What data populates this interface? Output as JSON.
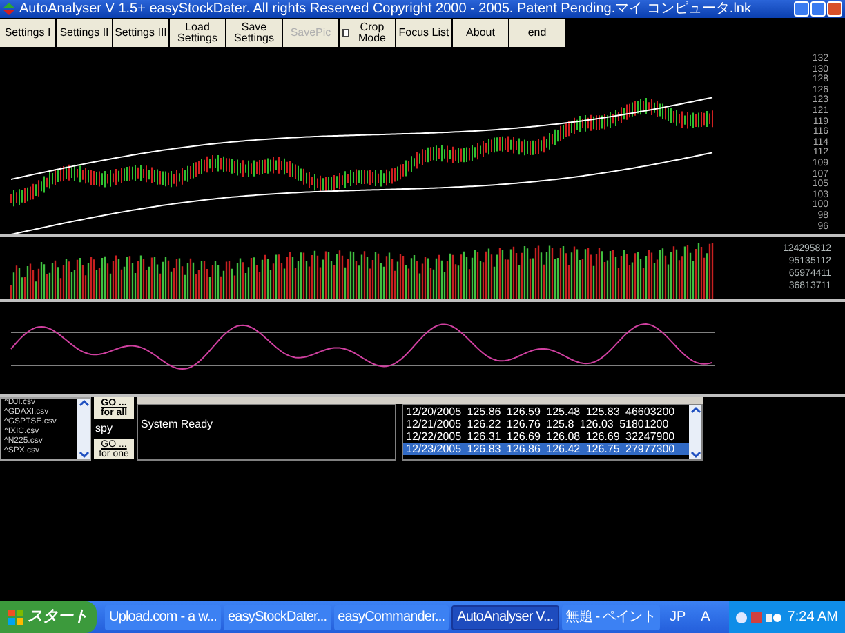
{
  "window": {
    "title": "AutoAnalyser V 1.5+ easyStockDater. All rights Reserved Copyright 2000 - 2005. Patent Pending.マイ コンピュータ.lnk"
  },
  "toolbar": [
    {
      "kind": "button",
      "label": "Settings I",
      "disabled": false
    },
    {
      "kind": "button",
      "label": "Settings II",
      "disabled": false
    },
    {
      "kind": "button",
      "label": "Settings III",
      "disabled": false
    },
    {
      "kind": "button",
      "label": "Load Settings",
      "disabled": false
    },
    {
      "kind": "button",
      "label": "Save Settings",
      "disabled": false
    },
    {
      "kind": "button",
      "label": "SavePic",
      "disabled": true
    },
    {
      "kind": "checkbox",
      "label": "Crop Mode",
      "checked": false
    },
    {
      "kind": "button",
      "label": "Focus List",
      "disabled": false
    },
    {
      "kind": "button",
      "label": "About",
      "disabled": false
    },
    {
      "kind": "button",
      "label": "end",
      "disabled": false
    }
  ],
  "price_axis_labels": [
    "132",
    "130",
    "128",
    "126",
    "123",
    "121",
    "119",
    "116",
    "114",
    "112",
    "109",
    "107",
    "105",
    "103",
    "100",
    "98",
    "96"
  ],
  "volume_axis_labels": [
    "124295812",
    "95135112",
    "65974411",
    "36813711"
  ],
  "symbols": [
    {
      "label": "^DJI.csv",
      "selected": false
    },
    {
      "label": "^GDAXI.csv",
      "selected": false
    },
    {
      "label": "^GSPTSE.csv",
      "selected": false
    },
    {
      "label": "^IXIC.csv",
      "selected": false
    },
    {
      "label": "^N225.csv",
      "selected": false
    },
    {
      "label": "^SPX.csv",
      "selected": false
    }
  ],
  "go_all": {
    "top": "GO ...",
    "bottom": "for all"
  },
  "symbol_input": {
    "value": "spy"
  },
  "go_one": {
    "top": "GO ...",
    "bottom": "for one"
  },
  "status": {
    "text": "System Ready"
  },
  "data_rows": [
    {
      "text": "12/20/2005 125.86 126.59 125.48 125.83 46603200",
      "selected": false
    },
    {
      "text": "12/21/2005 126.22 126.76 125.8 126.03 51801200",
      "selected": false
    },
    {
      "text": "12/22/2005 126.31 126.69 126.08 126.69 32247900",
      "selected": false
    },
    {
      "text": "12/23/2005 126.83 126.86 126.42 126.75 27977300",
      "selected": true
    }
  ],
  "taskbar": {
    "start": "スタート",
    "tasks": [
      {
        "label": "Upload.com - a w...",
        "selected": false
      },
      {
        "label": "easyStockDater...",
        "selected": false
      },
      {
        "label": "easyCommander...",
        "selected": false
      },
      {
        "label": "AutoAnalyser V...",
        "selected": true
      },
      {
        "label": "無題 - ペイント",
        "selected": false
      }
    ],
    "language": "JP",
    "ime": "A",
    "clock": "7:24 AM"
  }
}
